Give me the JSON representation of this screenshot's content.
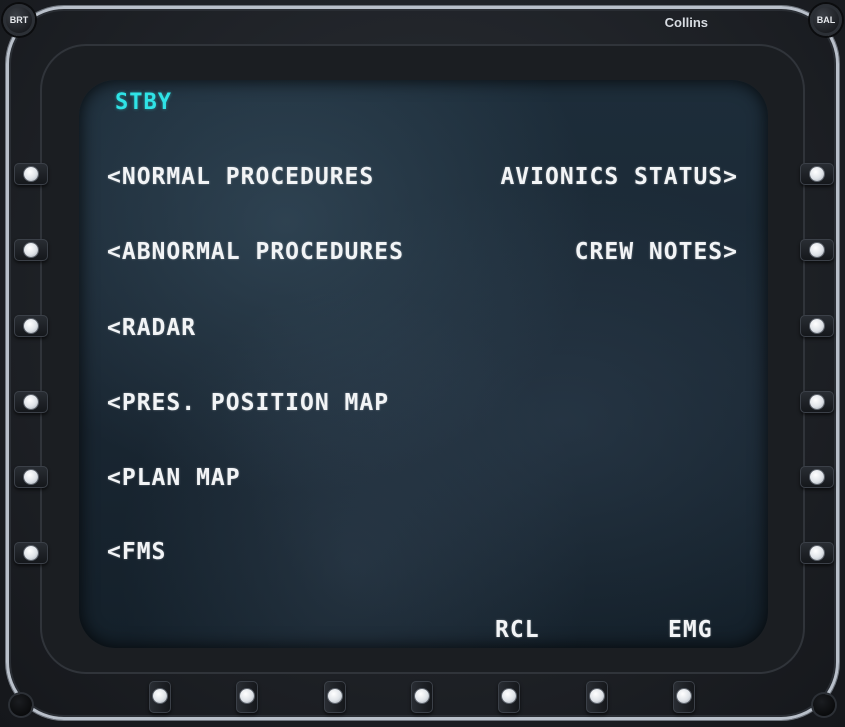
{
  "header": {
    "brand": "Collins",
    "knob_left": "BRT",
    "knob_right": "BAL"
  },
  "screen": {
    "status": "STBY",
    "left_items": [
      {
        "label": "<NORMAL PROCEDURES"
      },
      {
        "label": "<ABNORMAL PROCEDURES"
      },
      {
        "label": "<RADAR"
      },
      {
        "label": "<PRES. POSITION MAP"
      },
      {
        "label": "<PLAN MAP"
      },
      {
        "label": "<FMS"
      }
    ],
    "right_items": [
      {
        "label": "AVIONICS STATUS>"
      },
      {
        "label": "CREW NOTES>"
      }
    ],
    "bottom_items": [
      {
        "label": "RCL"
      },
      {
        "label": "EMG"
      }
    ]
  },
  "colors": {
    "status_cyan": "#2fe3e6",
    "menu_text": "#f2f4f6",
    "bezel": "#1e2126",
    "rim": "#b9c0ca"
  }
}
